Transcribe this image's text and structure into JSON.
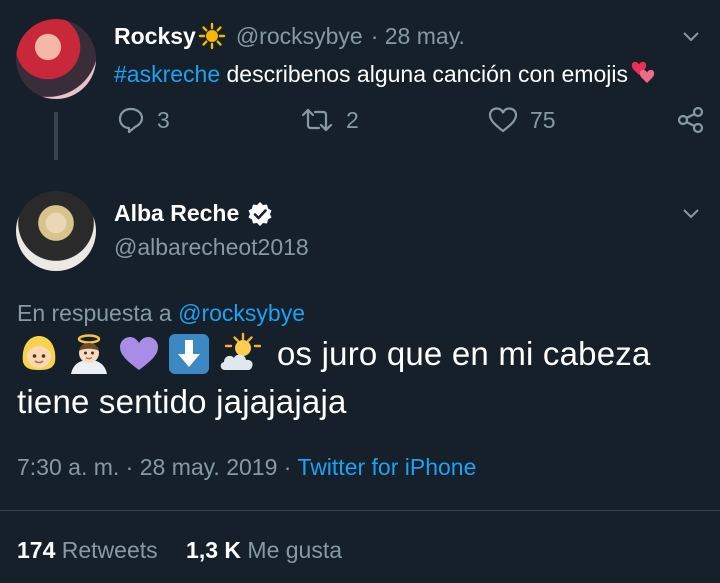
{
  "reply_context": {
    "author_name": "Rocksy",
    "author_handle": "@rocksybye",
    "date": "· 28 may.",
    "hashtag": "#askreche",
    "text": " describenos alguna canción con emojis",
    "replies": "3",
    "retweets": "2",
    "likes": "75"
  },
  "main_tweet": {
    "author_name": "Alba Reche",
    "author_handle": "@albarecheot2018",
    "reply_prefix": "En respuesta a ",
    "reply_to": "@rocksybye",
    "line1": "os juro que en mi cabeza",
    "line2": "tiene sentido jajajajaja",
    "timestamp": "7:30 a. m. · 28 may. 2019 ·",
    "source": "Twitter for iPhone",
    "retweets_count": "174",
    "retweets_label": "Retweets",
    "likes_count": "1,3 K",
    "likes_label": "Me gusta"
  },
  "colors": {
    "background": "#15202b",
    "link": "#1da1f2",
    "muted": "#8899a6",
    "divider": "#38444d"
  },
  "icons": [
    "sun-emoji",
    "heart-emoji",
    "chevron-down-icon",
    "reply-icon",
    "retweet-icon",
    "like-icon",
    "share-icon",
    "verified-badge-icon",
    "blonde-person-emoji",
    "angel-emoji",
    "purple-heart-emoji",
    "down-arrow-emoji",
    "sun-behind-cloud-emoji"
  ]
}
